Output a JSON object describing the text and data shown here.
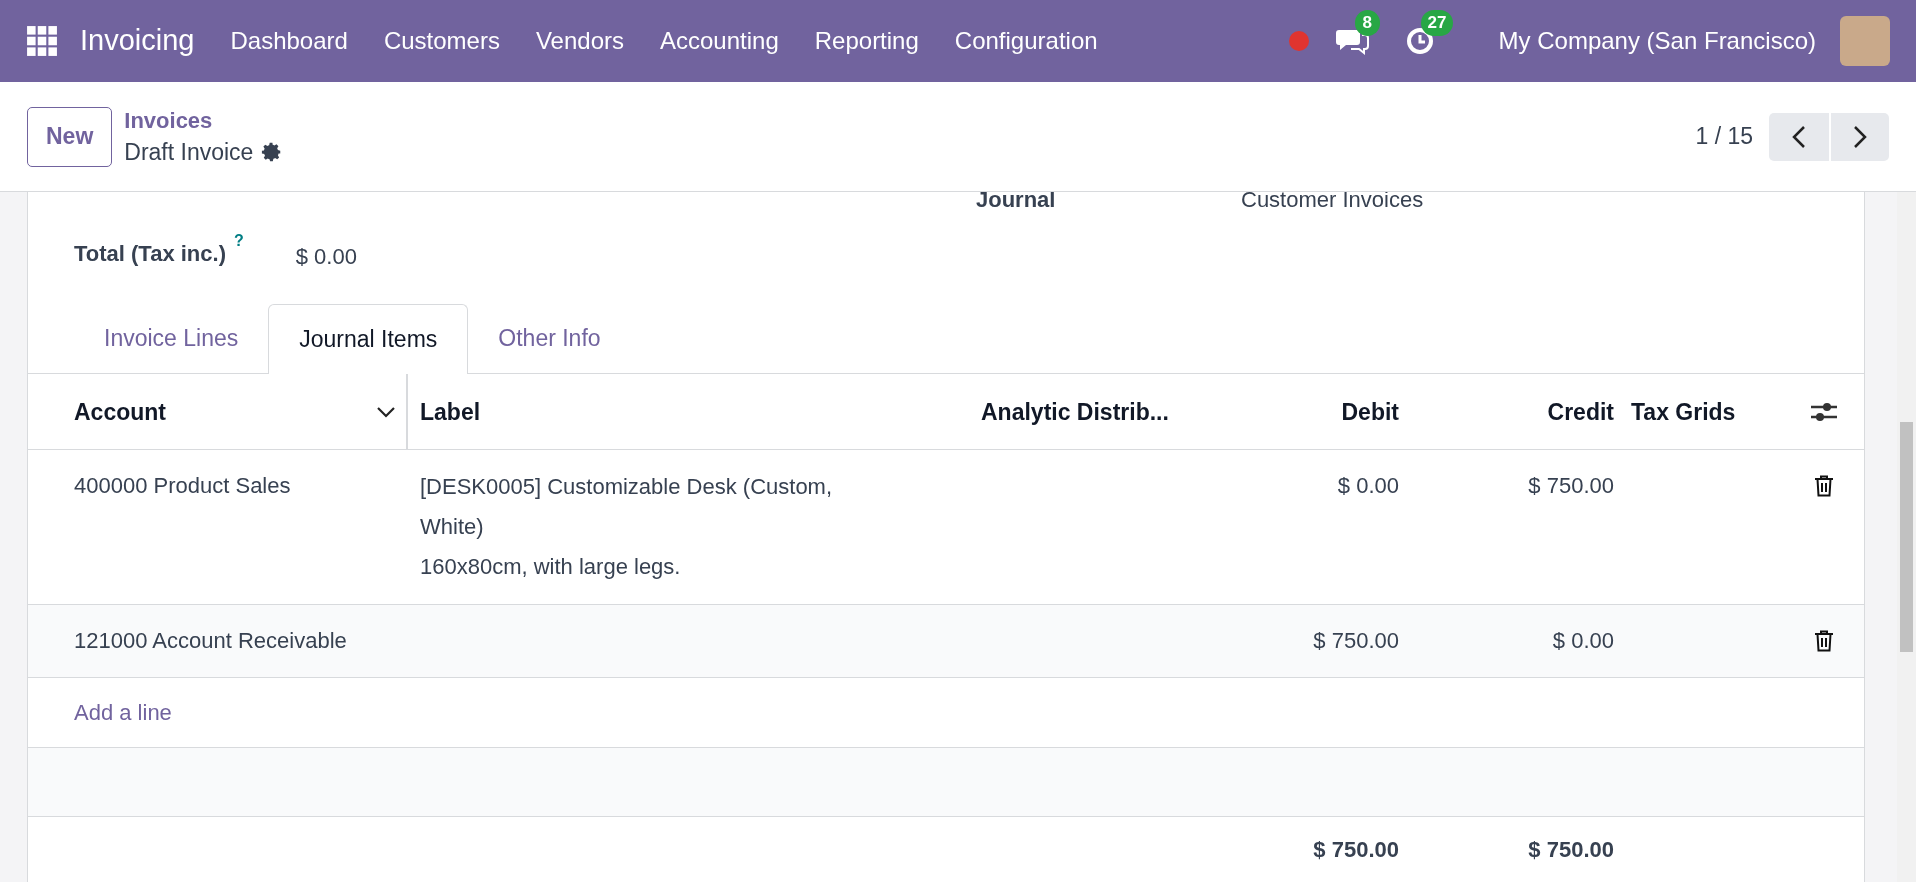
{
  "navbar": {
    "app_name": "Invoicing",
    "menu": [
      "Dashboard",
      "Customers",
      "Vendors",
      "Accounting",
      "Reporting",
      "Configuration"
    ],
    "messages_count": "8",
    "activities_count": "27",
    "company": "My Company (San Francisco)"
  },
  "control_panel": {
    "new_button": "New",
    "breadcrumb": "Invoices",
    "record_title": "Draft Invoice",
    "pager": "1 / 15"
  },
  "form": {
    "journal_label": "Journal",
    "journal_value": "Customer Invoices",
    "total_label": "Total (Tax inc.)",
    "total_help": "?",
    "total_value": "$ 0.00"
  },
  "tabs": [
    {
      "label": "Invoice Lines",
      "selected": false
    },
    {
      "label": "Journal Items",
      "selected": true
    },
    {
      "label": "Other Info",
      "selected": false
    }
  ],
  "table": {
    "columns": [
      "Account",
      "Label",
      "Analytic Distrib...",
      "Debit",
      "Credit",
      "Tax Grids"
    ],
    "rows": [
      {
        "account": "400000 Product Sales",
        "label": [
          "[DESK0005] Customizable Desk (Custom,",
          "White)",
          "160x80cm, with large legs."
        ],
        "debit": "$ 0.00",
        "credit": "$ 750.00"
      },
      {
        "account": "121000 Account Receivable",
        "label": [],
        "debit": "$ 750.00",
        "credit": "$ 0.00"
      }
    ],
    "add_line": "Add a line",
    "total_debit": "$ 750.00",
    "total_credit": "$ 750.00"
  }
}
